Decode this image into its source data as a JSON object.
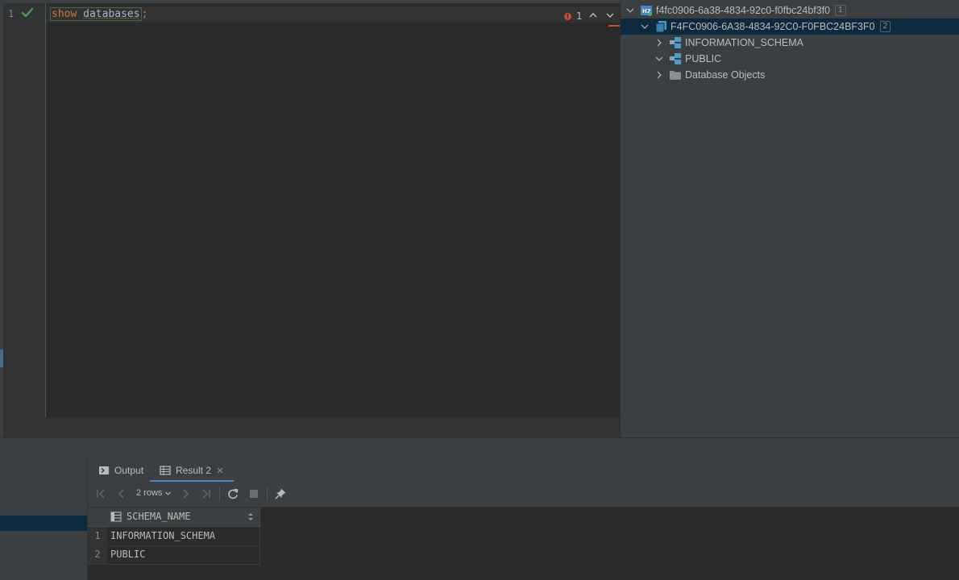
{
  "editor": {
    "line_number": "1",
    "code": {
      "keyword": "show",
      "space": " ",
      "identifier": "databases",
      "terminator": ";"
    },
    "error_count": "1"
  },
  "db_tree": {
    "connection": {
      "label": "f4fc0906-6a38-4834-92c0-f0fbc24bf3f0",
      "badge": "1",
      "icon": "h2-database-icon"
    },
    "database": {
      "label": "F4FC0906-6A38-4834-92C0-F0FBC24BF3F0",
      "badge": "2",
      "icon": "database-icon"
    },
    "schemas": [
      {
        "label": "INFORMATION_SCHEMA",
        "expanded": false,
        "icon": "schema-icon"
      },
      {
        "label": "PUBLIC",
        "expanded": true,
        "icon": "schema-icon"
      },
      {
        "label": "Database Objects",
        "expanded": false,
        "icon": "folder-icon"
      }
    ]
  },
  "results": {
    "tabs": [
      {
        "label": "Output",
        "icon": "console-icon"
      },
      {
        "label": "Result 2",
        "icon": "table-icon",
        "closable": true
      }
    ],
    "toolbar": {
      "rows_label": "2 rows"
    },
    "grid": {
      "columns": [
        "SCHEMA_NAME"
      ],
      "rows": [
        {
          "num": "1",
          "value": "INFORMATION_SCHEMA"
        },
        {
          "num": "2",
          "value": "PUBLIC"
        }
      ]
    }
  },
  "colors": {
    "accent": "#4a88c7",
    "selection": "#0d293e",
    "error": "#c74a3a",
    "keyword": "#cc7832",
    "success": "#499c54"
  }
}
